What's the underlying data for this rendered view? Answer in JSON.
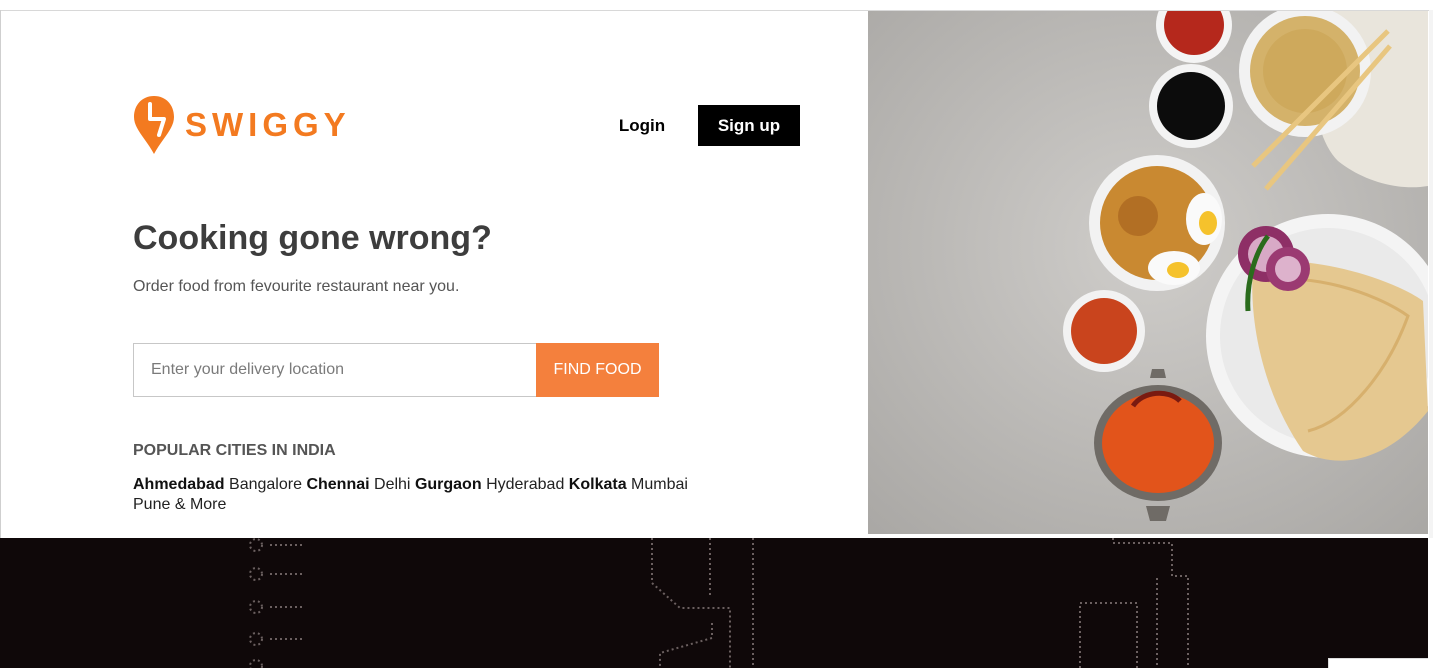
{
  "brand": {
    "name": "SWIGGY",
    "color": "#f37a20"
  },
  "header": {
    "login_label": "Login",
    "signup_label": "Sign up"
  },
  "hero": {
    "title": "Cooking gone wrong?",
    "subtitle": "Order food from fevourite restaurant near you."
  },
  "search": {
    "placeholder": "Enter your delivery location",
    "value": "",
    "button_label": "FIND FOOD",
    "button_color": "#f4803d"
  },
  "cities": {
    "title": "POPULAR CITIES IN INDIA",
    "items": [
      {
        "name": "Ahmedabad",
        "bold": true
      },
      {
        "name": "Bangalore",
        "bold": false
      },
      {
        "name": "Chennai",
        "bold": true
      },
      {
        "name": "Delhi",
        "bold": false
      },
      {
        "name": "Gurgaon",
        "bold": true
      },
      {
        "name": "Hyderabad",
        "bold": false
      },
      {
        "name": "Kolkata",
        "bold": true
      },
      {
        "name": "Mumbai",
        "bold": false
      },
      {
        "name": "Pune",
        "bold": false
      },
      {
        "name": "& More",
        "bold": false
      }
    ]
  },
  "colors": {
    "footer_bg": "#0f0809",
    "signup_bg": "#000000",
    "headline": "#3d3d3d"
  },
  "icons": [
    "swiggy-logo-icon",
    "food-spread-image",
    "footer-pattern"
  ]
}
